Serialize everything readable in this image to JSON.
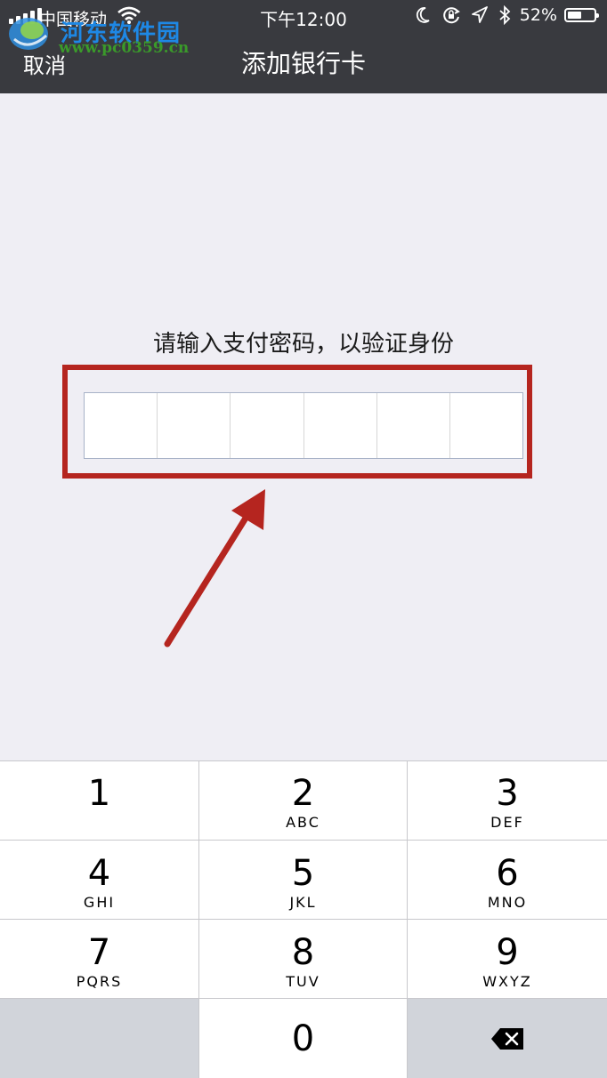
{
  "status_bar": {
    "carrier": "中国移动",
    "time": "下午12:00",
    "battery_pct": "52%",
    "battery_level": 0.52,
    "icons": [
      "signal-icon",
      "wifi-icon",
      "moon-icon",
      "rotation-lock-icon",
      "location-icon",
      "bluetooth-icon",
      "battery-icon"
    ]
  },
  "watermark": {
    "text": "河东软件园",
    "url": "www.pc0359.cn"
  },
  "navbar": {
    "cancel_label": "取消",
    "title": "添加银行卡"
  },
  "main": {
    "prompt": "请输入支付密码，以验证身份",
    "pin_length": 6
  },
  "annotation": {
    "highlight_color": "#b5251f"
  },
  "keypad": {
    "keys": [
      {
        "num": "1",
        "letters": ""
      },
      {
        "num": "2",
        "letters": "ABC"
      },
      {
        "num": "3",
        "letters": "DEF"
      },
      {
        "num": "4",
        "letters": "GHI"
      },
      {
        "num": "5",
        "letters": "JKL"
      },
      {
        "num": "6",
        "letters": "MNO"
      },
      {
        "num": "7",
        "letters": "PQRS"
      },
      {
        "num": "8",
        "letters": "TUV"
      },
      {
        "num": "9",
        "letters": "WXYZ"
      },
      {
        "num": "0",
        "letters": ""
      }
    ],
    "delete_icon": "backspace-icon"
  },
  "colors": {
    "navbar_bg": "#393a3f",
    "page_bg": "#efeef4",
    "keypad_gray": "#d1d4da"
  }
}
